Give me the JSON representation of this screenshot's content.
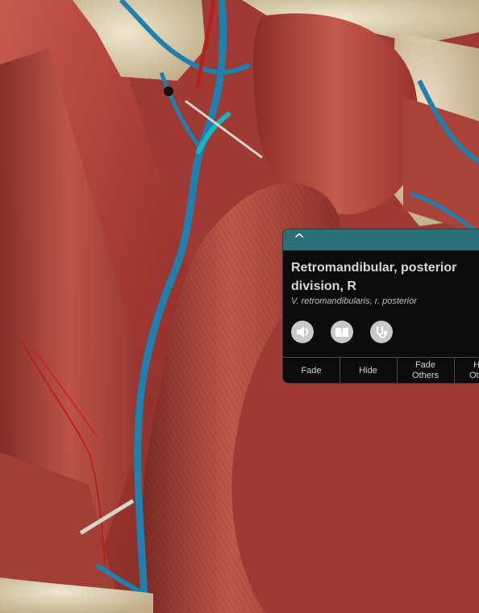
{
  "viewer": {
    "structure_title": "Retromandibular, posterior division, R",
    "latin_name": "V. retromandibularis, r. posterior",
    "collapse_glyph": "^",
    "icons": [
      "audio-icon",
      "book-icon",
      "stethoscope-icon"
    ],
    "actions": [
      "Fade",
      "Hide",
      "Fade\nOthers",
      "Hide\nOthers"
    ]
  },
  "colors": {
    "muscle": "#b2453c",
    "vein": "#1f7fae",
    "highlight": "#18b6c4",
    "bone": "#d8ccb0",
    "panel_header": "#2a6f75"
  }
}
